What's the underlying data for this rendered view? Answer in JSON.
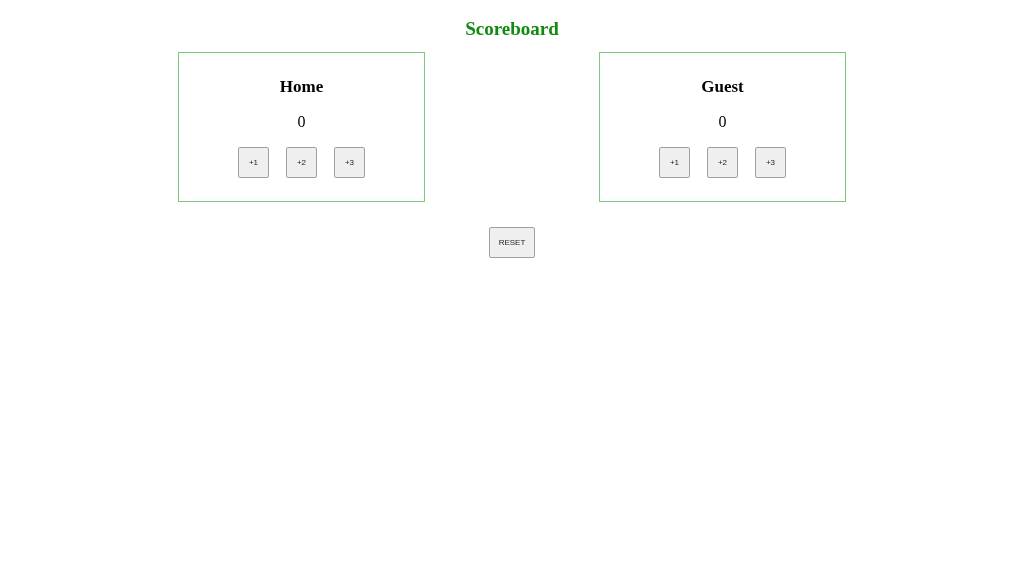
{
  "title": "Scoreboard",
  "teams": [
    {
      "name": "Home",
      "score": "0",
      "buttons": [
        "+1",
        "+2",
        "+3"
      ]
    },
    {
      "name": "Guest",
      "score": "0",
      "buttons": [
        "+1",
        "+2",
        "+3"
      ]
    }
  ],
  "reset_button": "RESET"
}
